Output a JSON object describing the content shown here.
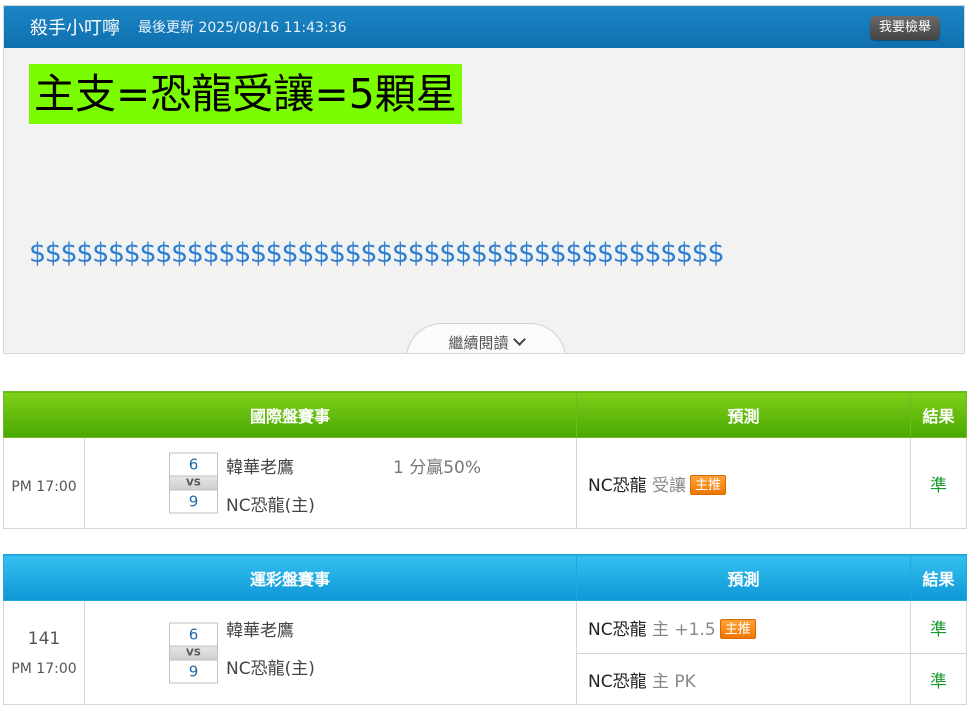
{
  "article": {
    "author": "殺手小叮嚀",
    "updated_label": "最後更新",
    "updated_time": "2025/08/16 11:43:36",
    "report_button": "我要檢舉",
    "headline": "主支=恐龍受讓=5顆星",
    "dollars": "$$$$$$$$$$$$$$$$$$$$$$$$$$$$$$$$$$$$$$$$$$$$",
    "read_more": "繼續閱讀",
    "headline_bg": "#7cfc00",
    "accent": "#1479bc"
  },
  "intl_table": {
    "header_match": "國際盤賽事",
    "header_pred": "預測",
    "header_result": "結果",
    "row": {
      "time": "PM 17:00",
      "away_score": "6",
      "vs": "VS",
      "home_score": "9",
      "away_team": "韓華老鷹",
      "home_team": "NC恐龍(主)",
      "odds": "1 分贏50%",
      "pred_team": "NC恐龍",
      "pred_type": "受讓",
      "badge": "主推",
      "result": "準"
    }
  },
  "lottery_table": {
    "header_match": "運彩盤賽事",
    "header_pred": "預測",
    "header_result": "結果",
    "row": {
      "game_no": "141",
      "time": "PM 17:00",
      "away_score": "6",
      "vs": "VS",
      "home_score": "9",
      "away_team": "韓華老鷹",
      "home_team": "NC恐龍(主)",
      "predictions": [
        {
          "team": "NC恐龍",
          "type": "主 +1.5",
          "badge": "主推",
          "result": "準"
        },
        {
          "team": "NC恐龍",
          "type": "主 PK",
          "badge": "",
          "result": "準"
        }
      ]
    }
  }
}
